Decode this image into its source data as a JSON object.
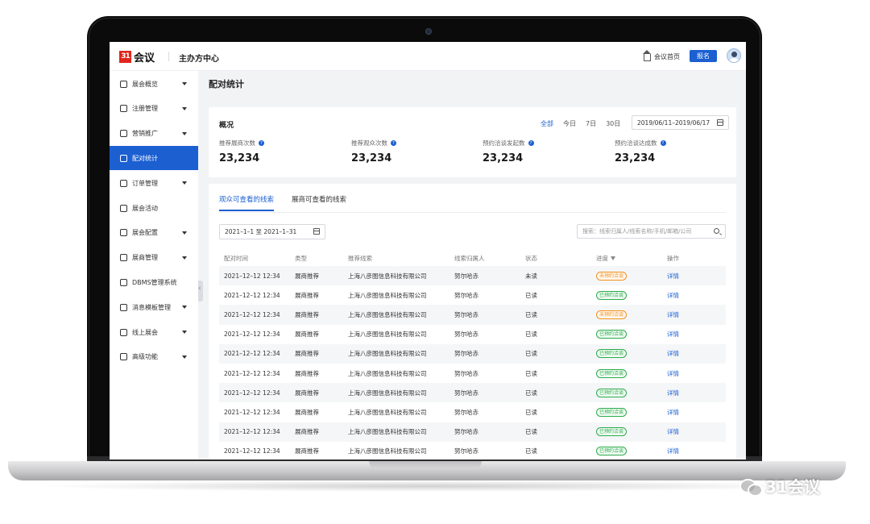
{
  "brand": {
    "logo_mark": "31",
    "logo_text": "会议",
    "center_title": "主办方中心"
  },
  "header": {
    "home_label": "会议首页",
    "signup_label": "报名"
  },
  "sidebar": {
    "items": [
      {
        "label": "展会概览",
        "icon": "overview-icon",
        "caret": true,
        "active": false
      },
      {
        "label": "注册管理",
        "icon": "user-icon",
        "caret": true,
        "active": false
      },
      {
        "label": "营销推广",
        "icon": "marketing-icon",
        "caret": true,
        "active": false
      },
      {
        "label": "配对统计",
        "icon": "match-icon",
        "caret": false,
        "active": true
      },
      {
        "label": "订单管理",
        "icon": "order-icon",
        "caret": true,
        "active": false
      },
      {
        "label": "展会活动",
        "icon": "event-icon",
        "caret": false,
        "active": false
      },
      {
        "label": "展会配置",
        "icon": "config-icon",
        "caret": true,
        "active": false
      },
      {
        "label": "展商管理",
        "icon": "exhibitor-icon",
        "caret": true,
        "active": false
      },
      {
        "label": "DBMS管理系统",
        "icon": "database-icon",
        "caret": false,
        "active": false
      },
      {
        "label": "消息模板管理",
        "icon": "message-icon",
        "caret": true,
        "active": false
      },
      {
        "label": "线上展会",
        "icon": "online-icon",
        "caret": true,
        "active": false
      },
      {
        "label": "高级功能",
        "icon": "grid-icon",
        "caret": true,
        "active": false
      }
    ]
  },
  "page": {
    "title": "配对统计"
  },
  "overview": {
    "title": "概况",
    "ranges": [
      "全部",
      "今日",
      "7日",
      "30日"
    ],
    "selected_range": "全部",
    "date_range": "2019/06/11–2019/06/17",
    "stats": [
      {
        "label": "推荐展商次数",
        "value": "23,234"
      },
      {
        "label": "推荐观众次数",
        "value": "23,234"
      },
      {
        "label": "预约洽谈发起数",
        "value": "23,234"
      },
      {
        "label": "预约洽谈达成数",
        "value": "23,234"
      }
    ]
  },
  "leads": {
    "tabs": [
      "观众可查看的线索",
      "展商可查看的线索"
    ],
    "active_tab": 0,
    "date_filter": "2021–1–1 至 2021–1–31",
    "search_placeholder": "搜索：线索归属人/线索名称/手机/邮箱/公司",
    "columns": [
      "配对时间",
      "类型",
      "推荐线索",
      "线索归属人",
      "状态",
      "进度",
      "操作"
    ],
    "rows": [
      {
        "time": "2021–12–12  12:34",
        "type": "展商推荐",
        "lead": "上海八彦图信息科技有限公司",
        "owner": "努尔哈赤",
        "status": "未读",
        "progress": "未预约洽谈",
        "progress_kind": "pending",
        "action": "详情"
      },
      {
        "time": "2021–12–12  12:34",
        "type": "展商推荐",
        "lead": "上海八彦图信息科技有限公司",
        "owner": "努尔哈赤",
        "status": "已读",
        "progress": "已预约洽谈",
        "progress_kind": "done",
        "action": "详情"
      },
      {
        "time": "2021–12–12  12:34",
        "type": "展商推荐",
        "lead": "上海八彦图信息科技有限公司",
        "owner": "努尔哈赤",
        "status": "已读",
        "progress": "未预约洽谈",
        "progress_kind": "pending",
        "action": "详情"
      },
      {
        "time": "2021–12–12  12:34",
        "type": "展商推荐",
        "lead": "上海八彦图信息科技有限公司",
        "owner": "努尔哈赤",
        "status": "已读",
        "progress": "已预约洽谈",
        "progress_kind": "done",
        "action": "详情"
      },
      {
        "time": "2021–12–12  12:34",
        "type": "展商推荐",
        "lead": "上海八彦图信息科技有限公司",
        "owner": "努尔哈赤",
        "status": "已读",
        "progress": "已预约洽谈",
        "progress_kind": "done",
        "action": "详情"
      },
      {
        "time": "2021–12–12  12:34",
        "type": "展商推荐",
        "lead": "上海八彦图信息科技有限公司",
        "owner": "努尔哈赤",
        "status": "已读",
        "progress": "已预约洽谈",
        "progress_kind": "done",
        "action": "详情"
      },
      {
        "time": "2021–12–12  12:34",
        "type": "展商推荐",
        "lead": "上海八彦图信息科技有限公司",
        "owner": "努尔哈赤",
        "status": "已读",
        "progress": "已预约洽谈",
        "progress_kind": "done",
        "action": "详情"
      },
      {
        "time": "2021–12–12  12:34",
        "type": "展商推荐",
        "lead": "上海八彦图信息科技有限公司",
        "owner": "努尔哈赤",
        "status": "已读",
        "progress": "已预约洽谈",
        "progress_kind": "done",
        "action": "详情"
      },
      {
        "time": "2021–12–12  12:34",
        "type": "展商推荐",
        "lead": "上海八彦图信息科技有限公司",
        "owner": "努尔哈赤",
        "status": "已读",
        "progress": "已预约洽谈",
        "progress_kind": "done",
        "action": "详情"
      },
      {
        "time": "2021–12–12  12:34",
        "type": "展商推荐",
        "lead": "上海八彦图信息科技有限公司",
        "owner": "努尔哈赤",
        "status": "已读",
        "progress": "已预约洽谈",
        "progress_kind": "done",
        "action": "详情"
      }
    ]
  },
  "watermark": {
    "text": "31会议"
  },
  "colors": {
    "primary": "#1b5fd1",
    "pending": "#f5901d",
    "done": "#2bab4b",
    "logo_red": "#e1251b"
  }
}
